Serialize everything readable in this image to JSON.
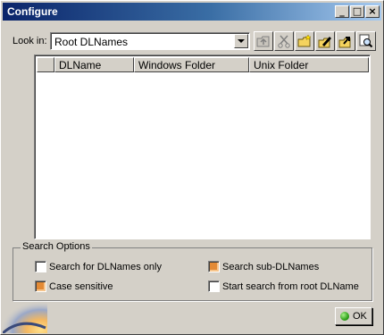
{
  "window": {
    "title": "Configure"
  },
  "titlebar_buttons": {
    "minimize": "_",
    "maximize": "□",
    "close": "×"
  },
  "lookin": {
    "label": "Look in:",
    "value": "Root DLNames"
  },
  "toolbar": [
    "up-folder-icon",
    "cut-icon",
    "new-folder-icon",
    "edit-icon",
    "export-icon",
    "find-icon"
  ],
  "list": {
    "columns": [
      "DLName",
      "Windows Folder",
      "Unix Folder"
    ],
    "rows": []
  },
  "search_options": {
    "title": "Search Options",
    "dlnames_only": {
      "label": "Search for DLNames only",
      "checked": false
    },
    "sub_dlnames": {
      "label": "Search sub-DLNames",
      "checked": true
    },
    "case_sensitive": {
      "label": "Case sensitive",
      "checked": true
    },
    "from_root": {
      "label": "Start search from root DLName",
      "checked": false
    }
  },
  "ok_button": {
    "label": "OK"
  },
  "colors": {
    "title_start": "#0a246a",
    "title_end": "#a6caf0",
    "checked": "#e38a35",
    "ok_dot": "#2fa21a"
  }
}
